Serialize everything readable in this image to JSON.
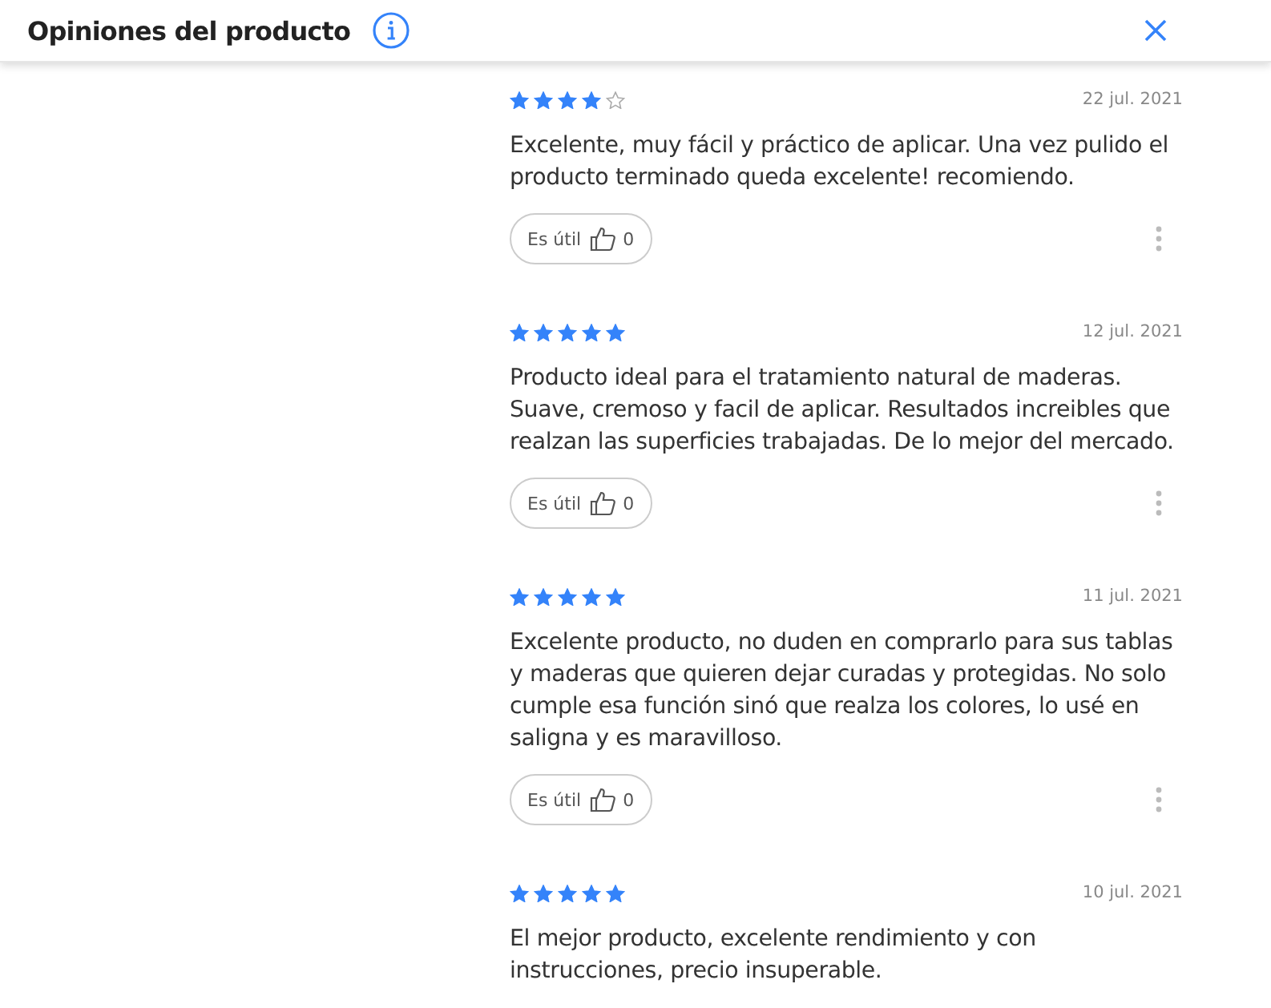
{
  "header": {
    "title": "Opiniones del producto"
  },
  "reviews": [
    {
      "stars": 4,
      "date": "22 jul. 2021",
      "text": "Excelente, muy fácil y práctico de aplicar. Una vez pulido el producto terminado queda excelente! recomiendo.",
      "helpful": {
        "label": "Es útil",
        "count": "0"
      }
    },
    {
      "stars": 5,
      "date": "12 jul. 2021",
      "text": "Producto ideal para el tratamiento natural de maderas. Suave, cremoso y facil de aplicar. Resultados increibles que realzan las superficies trabajadas. De lo mejor del mercado.",
      "helpful": {
        "label": "Es útil",
        "count": "0"
      }
    },
    {
      "stars": 5,
      "date": "11 jul. 2021",
      "text": "Excelente producto, no duden en comprarlo para sus tablas y maderas que quieren dejar curadas y protegidas. No solo cumple esa función sinó que realza los colores, lo usé en saligna y es maravilloso.",
      "helpful": {
        "label": "Es útil",
        "count": "0"
      }
    },
    {
      "stars": 5,
      "date": "10 jul. 2021",
      "text": "El mejor producto, excelente rendimiento y con instrucciones, precio insuperable."
    }
  ]
}
